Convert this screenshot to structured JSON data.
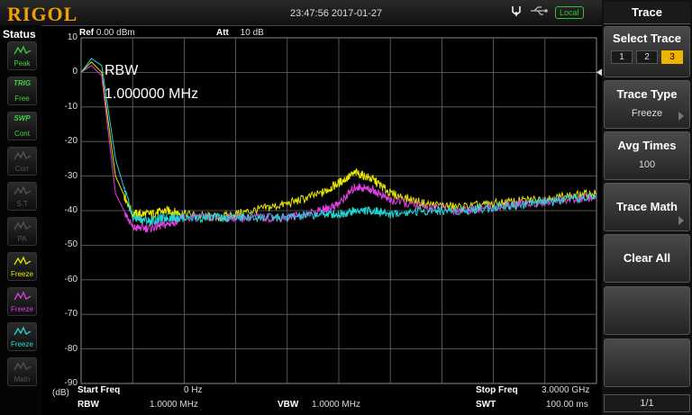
{
  "brand": "RIGOL",
  "clock": "23:47:56 2017-01-27",
  "local_label": "Local",
  "status": {
    "title": "Status",
    "buttons": [
      {
        "top": "",
        "label": "Peak",
        "color": "#3fd13f",
        "icon": "peak-wave-icon"
      },
      {
        "top": "TRIG",
        "label": "Free",
        "color": "#3fd13f",
        "icon": "trigger-icon"
      },
      {
        "top": "SWP",
        "label": "Cont",
        "color": "#3fd13f",
        "icon": "sweep-icon"
      },
      {
        "top": "",
        "label": "Corr",
        "color": "#555555",
        "icon": "correction-icon"
      },
      {
        "top": "",
        "label": "S.T",
        "color": "#555555",
        "icon": "signal-track-icon"
      },
      {
        "top": "",
        "label": "PA",
        "color": "#555555",
        "icon": "preamp-icon"
      },
      {
        "top": "",
        "label": "Freeze",
        "color": "#e8e800",
        "icon": "trace1-wave-icon"
      },
      {
        "top": "",
        "label": "Freeze",
        "color": "#e040e0",
        "icon": "trace2-wave-icon"
      },
      {
        "top": "",
        "label": "Freeze",
        "color": "#20d8d8",
        "icon": "trace3-wave-icon"
      },
      {
        "top": "",
        "label": "Math",
        "color": "#555555",
        "icon": "math-icon"
      }
    ]
  },
  "header": {
    "ref_label": "Ref",
    "ref_value": "0.00 dBm",
    "att_label": "Att",
    "att_value": "10 dB"
  },
  "overlay": {
    "rbw_label": "RBW",
    "rbw_value": "1.000000 MHz"
  },
  "y_unit": "(dB)",
  "footer": {
    "start_label": "Start Freq",
    "start_value": "0 Hz",
    "stop_label": "Stop Freq",
    "stop_value": "3.0000 GHz",
    "rbw_label": "RBW",
    "rbw_value": "1.0000 MHz",
    "vbw_label": "VBW",
    "vbw_value": "1.0000 MHz",
    "swt_label": "SWT",
    "swt_value": "100.00 ms"
  },
  "menu": {
    "title": "Trace",
    "select_trace": {
      "label": "Select Trace",
      "options": [
        "1",
        "2",
        "3"
      ],
      "selected": "3"
    },
    "trace_type": {
      "label": "Trace Type",
      "value": "Freeze"
    },
    "avg_times": {
      "label": "Avg Times",
      "value": "100"
    },
    "trace_math": {
      "label": "Trace Math"
    },
    "clear_all": {
      "label": "Clear All"
    },
    "page": "1/1"
  },
  "chart_data": {
    "type": "line",
    "xlabel": "",
    "ylabel": "(dB)",
    "xlim": [
      0,
      3.0
    ],
    "ylim": [
      -90,
      10
    ],
    "x_unit": "GHz",
    "y_ticks": [
      "10",
      "0",
      "-10",
      "-20",
      "-30",
      "-40",
      "-50",
      "-60",
      "-70",
      "-80",
      "-90"
    ],
    "grid": true,
    "series": [
      {
        "color": "#e8e800",
        "x": [
          0.0,
          0.06,
          0.12,
          0.2,
          0.3,
          0.4,
          0.5,
          0.6,
          0.8,
          1.0,
          1.2,
          1.4,
          1.5,
          1.6,
          1.7,
          1.8,
          2.0,
          2.2,
          2.4,
          2.6,
          2.8,
          3.0
        ],
        "y": [
          0,
          3,
          0,
          -30,
          -41,
          -41,
          -40,
          -41,
          -42,
          -40,
          -38,
          -35,
          -32,
          -29,
          -31,
          -35,
          -38,
          -39,
          -38,
          -37,
          -36,
          -35
        ]
      },
      {
        "color": "#e040e0",
        "x": [
          0.0,
          0.06,
          0.12,
          0.2,
          0.3,
          0.4,
          0.5,
          0.6,
          0.8,
          1.0,
          1.2,
          1.4,
          1.5,
          1.6,
          1.7,
          1.8,
          2.0,
          2.2,
          2.4,
          2.6,
          2.8,
          3.0
        ],
        "y": [
          0,
          2,
          -1,
          -35,
          -45,
          -45,
          -44,
          -42,
          -42,
          -42,
          -42,
          -40,
          -38,
          -33,
          -34,
          -37,
          -39,
          -40,
          -39,
          -38,
          -37,
          -36
        ]
      },
      {
        "color": "#20d8d8",
        "x": [
          0.0,
          0.06,
          0.12,
          0.2,
          0.3,
          0.4,
          0.5,
          0.6,
          0.8,
          1.0,
          1.2,
          1.4,
          1.5,
          1.6,
          1.7,
          1.8,
          2.0,
          2.2,
          2.4,
          2.6,
          2.8,
          3.0
        ],
        "y": [
          0,
          4,
          2,
          -25,
          -42,
          -43,
          -42,
          -42,
          -42,
          -42,
          -42,
          -41,
          -41,
          -40,
          -40,
          -41,
          -40,
          -40,
          -39,
          -38,
          -37,
          -36
        ]
      }
    ]
  }
}
